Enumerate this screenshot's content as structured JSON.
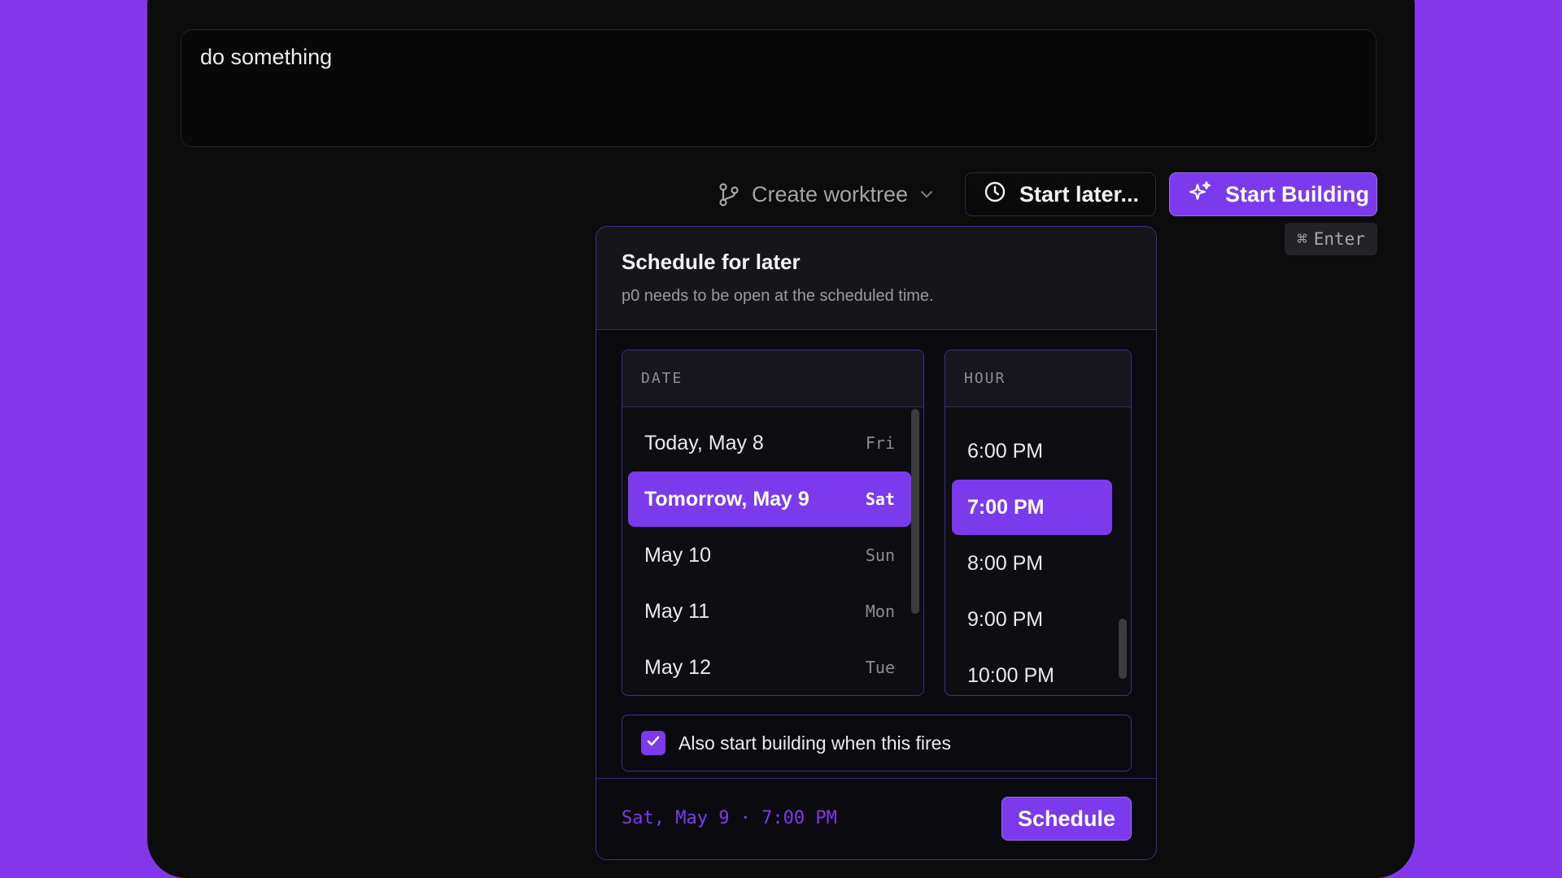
{
  "prompt": {
    "value": "do something"
  },
  "toolbar": {
    "worktree_label": "Create worktree",
    "start_later_label": "Start later...",
    "start_building_label": "Start Building",
    "shortcut_key": "⌘",
    "shortcut_label": "Enter"
  },
  "schedule": {
    "title": "Schedule for later",
    "subtitle": "p0 needs to be open at the scheduled time.",
    "date_header": "DATE",
    "hour_header": "HOUR",
    "dates": [
      {
        "label": "Today, May 8",
        "day": "Fri",
        "selected": false
      },
      {
        "label": "Tomorrow, May 9",
        "day": "Sat",
        "selected": true
      },
      {
        "label": "May 10",
        "day": "Sun",
        "selected": false
      },
      {
        "label": "May 11",
        "day": "Mon",
        "selected": false
      },
      {
        "label": "May 12",
        "day": "Tue",
        "selected": false
      }
    ],
    "hours": [
      {
        "label": "6:00 PM",
        "selected": false
      },
      {
        "label": "7:00 PM",
        "selected": true
      },
      {
        "label": "8:00 PM",
        "selected": false
      },
      {
        "label": "9:00 PM",
        "selected": false
      },
      {
        "label": "10:00 PM",
        "selected": false
      }
    ],
    "also_build_label": "Also start building when this fires",
    "also_build_checked": true,
    "summary": "Sat, May 9 · 7:00 PM",
    "schedule_label": "Schedule"
  },
  "colors": {
    "accent": "#7c3aed",
    "background": "#8336ea",
    "panel": "#0c0c0d"
  }
}
